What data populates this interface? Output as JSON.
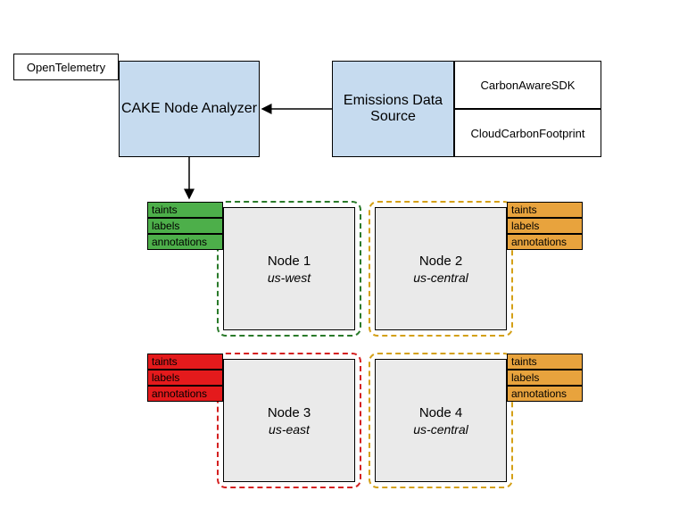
{
  "opentelemetry": "OpenTelemetry",
  "analyzer": "CAKE Node Analyzer",
  "emissions": "Emissions Data Source",
  "sdk": "CarbonAwareSDK",
  "ccf": "CloudCarbonFootprint",
  "labels": {
    "taints": "taints",
    "labels": "labels",
    "annotations": "annotations"
  },
  "nodes": {
    "n1": {
      "title": "Node 1",
      "region": "us-west"
    },
    "n2": {
      "title": "Node 2",
      "region": "us-central"
    },
    "n3": {
      "title": "Node 3",
      "region": "us-east"
    },
    "n4": {
      "title": "Node 4",
      "region": "us-central"
    }
  }
}
